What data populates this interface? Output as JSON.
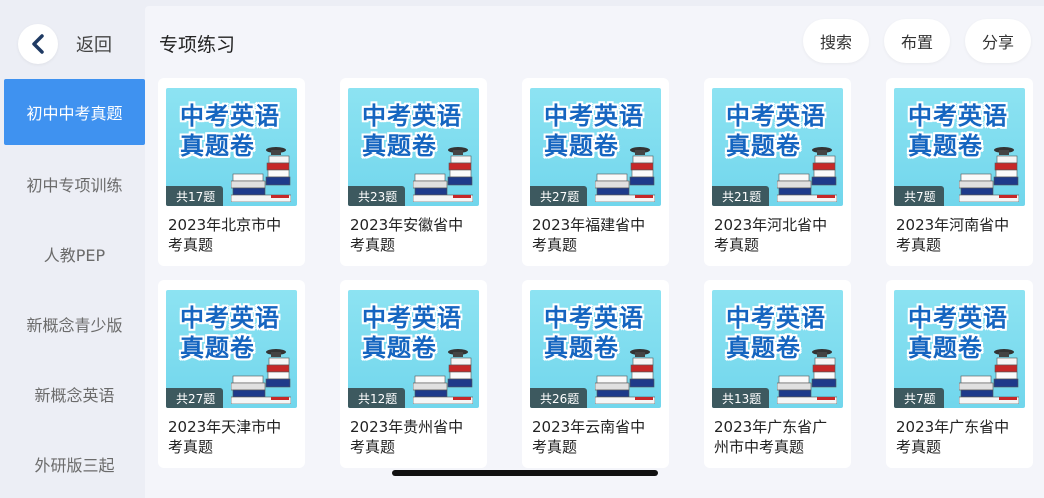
{
  "nav": {
    "back_label": "返回"
  },
  "sidebar": {
    "items": [
      {
        "label": "初中中考真题",
        "active": true
      },
      {
        "label": "初中专项训练",
        "active": false
      },
      {
        "label": "人教PEP",
        "active": false
      },
      {
        "label": "新概念青少版",
        "active": false
      },
      {
        "label": "新概念英语",
        "active": false
      },
      {
        "label": "外研版三起",
        "active": false
      }
    ]
  },
  "header": {
    "title": "专项练习",
    "search_label": "搜索",
    "assign_label": "布置",
    "share_label": "分享"
  },
  "cover": {
    "line1": "中考英语",
    "line2": "真题卷"
  },
  "cards": [
    {
      "count": "共17题",
      "title": "2023年北京市中考真题"
    },
    {
      "count": "共23题",
      "title": "2023年安徽省中考真题"
    },
    {
      "count": "共27题",
      "title": "2023年福建省中考真题"
    },
    {
      "count": "共21题",
      "title": "2023年河北省中考真题"
    },
    {
      "count": "共7题",
      "title": "2023年河南省中考真题"
    },
    {
      "count": "共27题",
      "title": "2023年天津市中考真题"
    },
    {
      "count": "共12题",
      "title": "2023年贵州省中考真题"
    },
    {
      "count": "共26题",
      "title": "2023年云南省中考真题"
    },
    {
      "count": "共13题",
      "title": "2023年广东省广州市中考真题"
    },
    {
      "count": "共7题",
      "title": "2023年广东省中考真题"
    }
  ],
  "colors": {
    "accent": "#3f92f0",
    "cover_title": "#1565c0",
    "cover_bg": "#7ddcef"
  }
}
